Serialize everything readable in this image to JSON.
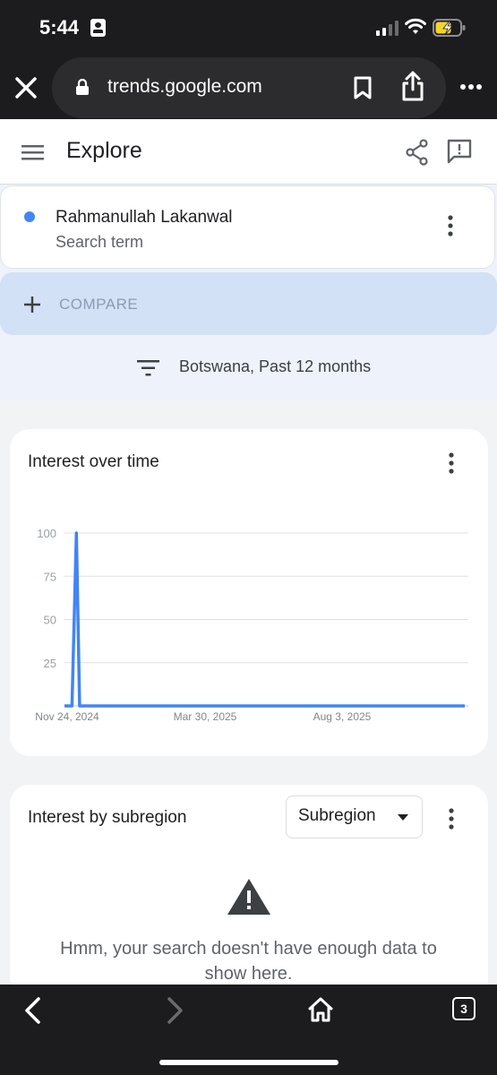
{
  "status_bar": {
    "time": "5:44"
  },
  "browser": {
    "url": "trends.google.com",
    "tab_count": "3"
  },
  "header": {
    "title": "Explore"
  },
  "search_term": {
    "name": "Rahmanullah Lakanwal",
    "type": "Search term",
    "color": "#4285f4"
  },
  "compare": {
    "label": "COMPARE"
  },
  "filter": {
    "text": "Botswana, Past 12 months"
  },
  "interest_over_time": {
    "title": "Interest over time"
  },
  "chart_data": {
    "type": "line",
    "title": "Interest over time",
    "x_tick_labels": [
      "Nov 24, 2024",
      "Mar 30, 2025",
      "Aug 3, 2025"
    ],
    "y_tick_labels": [
      "100",
      "75",
      "50",
      "25"
    ],
    "ylim": [
      0,
      100
    ],
    "grid": true,
    "series": [
      {
        "color": "#4285f4",
        "points": [
          {
            "x": "2024-11-17",
            "y": 0
          },
          {
            "x": "2024-11-24",
            "y": 0
          },
          {
            "x": "2024-11-28",
            "y": 100
          },
          {
            "x": "2024-12-01",
            "y": 0
          },
          {
            "x": "2025-11-23",
            "y": 0
          }
        ]
      }
    ]
  },
  "subregion": {
    "title": "Interest by subregion",
    "select_value": "Subregion",
    "message": "Hmm, your search doesn't have enough data to show here."
  }
}
